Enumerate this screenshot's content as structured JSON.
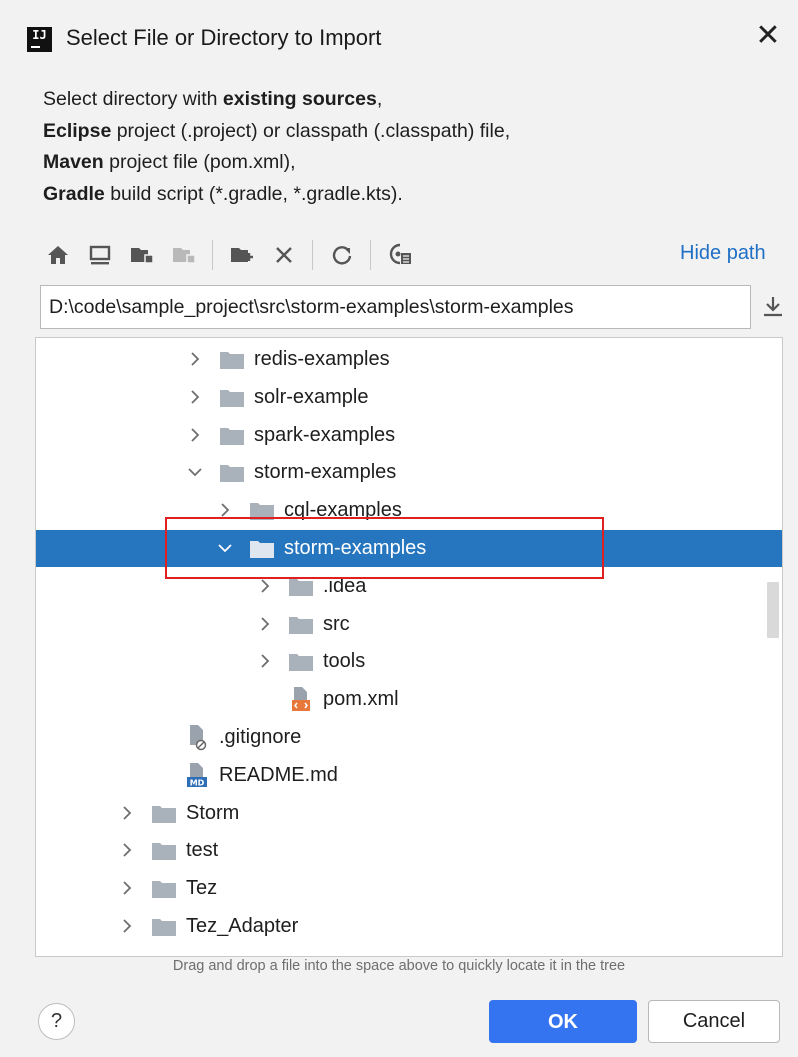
{
  "window": {
    "app_logo": "IJ",
    "title": "Select File or Directory to Import",
    "close_glyph": "✕"
  },
  "description": {
    "line1_pre": "Select directory with ",
    "line1_bold": "existing sources",
    "line1_post": ",",
    "line2_bold": "Eclipse",
    "line2_post": " project (.project) or classpath (.classpath) file,",
    "line3_bold": "Maven",
    "line3_post": " project file (pom.xml),",
    "line4_bold": "Gradle",
    "line4_post": " build script (*.gradle, *.gradle.kts)."
  },
  "toolbar": {
    "icons": [
      "home-icon",
      "desktop-icon",
      "project-folder-icon",
      "module-folder-icon",
      "new-folder-icon",
      "delete-icon",
      "refresh-icon",
      "show-hidden-icon"
    ],
    "hide_path_label": "Hide path"
  },
  "path": {
    "value": "D:\\code\\sample_project\\src\\storm-examples\\storm-examples"
  },
  "tree": {
    "rows": [
      {
        "label": "redis-examples",
        "type": "folder",
        "chevron": "right",
        "selected": false
      },
      {
        "label": "solr-example",
        "type": "folder",
        "chevron": "right",
        "selected": false
      },
      {
        "label": "spark-examples",
        "type": "folder",
        "chevron": "right",
        "selected": false
      },
      {
        "label": "storm-examples",
        "type": "folder",
        "chevron": "down",
        "selected": false
      },
      {
        "label": "cql-examples",
        "type": "folder",
        "chevron": "right",
        "selected": false
      },
      {
        "label": "storm-examples",
        "type": "folder",
        "chevron": "down",
        "selected": true
      },
      {
        "label": ".idea",
        "type": "folder",
        "chevron": "right",
        "selected": false
      },
      {
        "label": "src",
        "type": "folder",
        "chevron": "right",
        "selected": false
      },
      {
        "label": "tools",
        "type": "folder",
        "chevron": "right",
        "selected": false
      },
      {
        "label": "pom.xml",
        "type": "xml-file",
        "chevron": "none",
        "selected": false
      },
      {
        "label": ".gitignore",
        "type": "ignore-file",
        "chevron": "none",
        "selected": false
      },
      {
        "label": "README.md",
        "type": "md-file",
        "chevron": "none",
        "selected": false
      },
      {
        "label": "Storm",
        "type": "folder",
        "chevron": "right",
        "selected": false
      },
      {
        "label": "test",
        "type": "folder",
        "chevron": "right",
        "selected": false
      },
      {
        "label": "Tez",
        "type": "folder",
        "chevron": "right",
        "selected": false
      },
      {
        "label": "Tez_Adapter",
        "type": "folder",
        "chevron": "right",
        "selected": false
      }
    ]
  },
  "hint": "Drag and drop a file into the space above to quickly locate it in the tree",
  "buttons": {
    "help": "?",
    "ok": "OK",
    "cancel": "Cancel"
  },
  "colors": {
    "selection": "#2675bf",
    "link": "#1f6fc5",
    "ok_button": "#3574f0",
    "annotation_box": "#e02020",
    "folder": "#a9b1bb"
  }
}
